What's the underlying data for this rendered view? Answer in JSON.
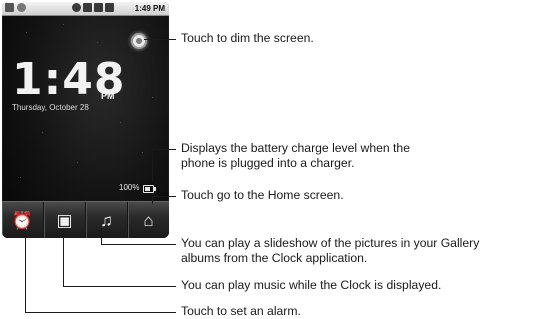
{
  "phone": {
    "status_time": "1:49 PM",
    "clock_time": "1:48",
    "clock_ampm": "PM",
    "clock_date": "Thursday, October 28",
    "battery_text": "100%",
    "dock": [
      {
        "icon": "alarm-clock-icon",
        "glyph": "⏰"
      },
      {
        "icon": "slideshow-icon",
        "glyph": "▣"
      },
      {
        "icon": "music-note-icon",
        "glyph": "♫"
      },
      {
        "icon": "home-icon",
        "glyph": "⌂"
      }
    ]
  },
  "callouts": {
    "dim": "Touch to dim the screen.",
    "battery_line1": "Displays the battery charge level when the",
    "battery_line2": "phone is plugged into a charger.",
    "home": "Touch go to the Home screen.",
    "slideshow_line1": "You can play a slideshow of the pictures in your Gallery",
    "slideshow_line2": "albums from the Clock application.",
    "music": "You can play music while the Clock is displayed.",
    "alarm": "Touch to set an alarm."
  },
  "colors": {
    "callout_line": "#1a1a1a",
    "screen_bg": "#121212",
    "statusbar_bg": "#dcdcdc"
  }
}
